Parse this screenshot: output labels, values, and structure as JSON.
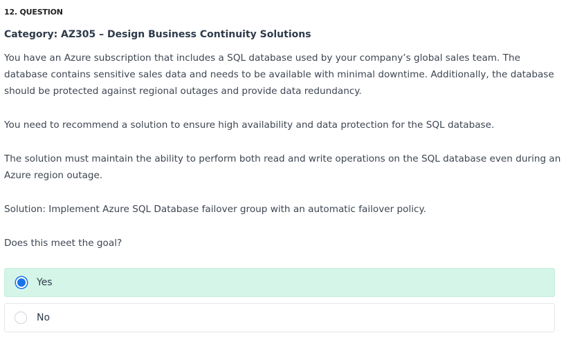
{
  "question": {
    "number_label": "12. QUESTION",
    "category": "Category: AZ305 – Design Business Continuity Solutions",
    "paragraphs": [
      "You have an Azure subscription that includes a SQL database used by your company’s global sales team. The database contains sensitive sales data and needs to be available with minimal downtime. Additionally, the database should be protected against regional outages and provide data redundancy.",
      "You need to recommend a solution to ensure high availability and data protection for the SQL database.",
      "The solution must maintain the ability to perform both read and write operations on the SQL database even during an Azure region outage.",
      "Solution: Implement Azure SQL Database failover group with an automatic failover policy.",
      "Does this meet the goal?"
    ]
  },
  "options": [
    {
      "label": "Yes",
      "selected": true
    },
    {
      "label": "No",
      "selected": false
    }
  ],
  "colors": {
    "selected_bg": "#d4f5e8",
    "radio_accent": "#1a73e8",
    "text": "#3d4551"
  }
}
